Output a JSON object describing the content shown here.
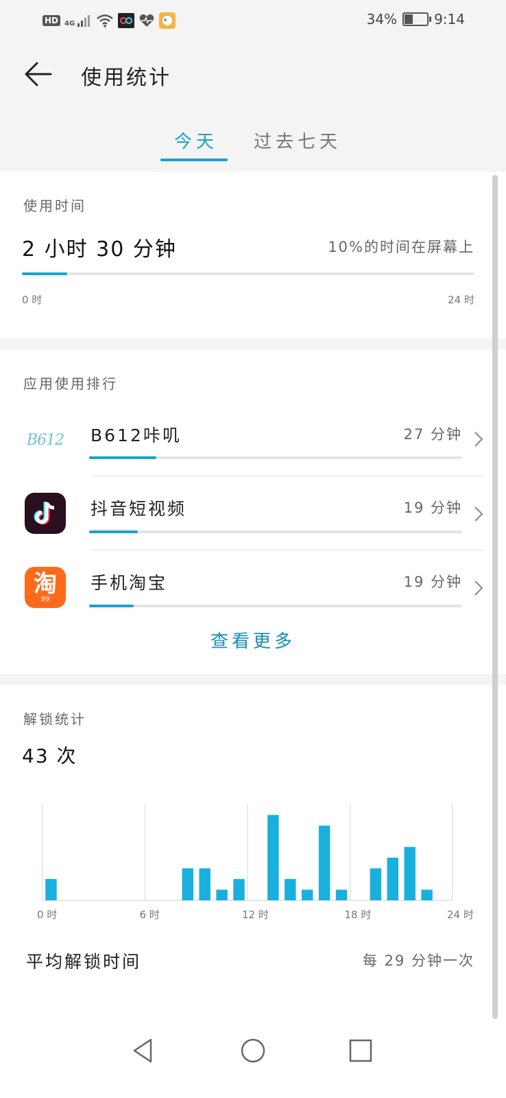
{
  "status_bar": {
    "network_hd": "HD",
    "network_4g": "4G",
    "battery_percent": "34%",
    "battery_level": 0.34,
    "time": "9:14"
  },
  "header": {
    "title": "使用统计",
    "tabs": [
      {
        "label": "今天",
        "selected": true
      },
      {
        "label": "过去七天",
        "selected": false
      }
    ]
  },
  "usage": {
    "section_label": "使用时间",
    "total": "2 小时 30 分钟",
    "screen_percent_text": "10%的时间在屏幕上",
    "progress_fraction": 0.1,
    "start_label": "0 时",
    "end_label": "24 时"
  },
  "ranking": {
    "section_label": "应用使用排行",
    "apps": [
      {
        "name": "B612咔叽",
        "time": "27 分钟",
        "fraction": 0.18,
        "icon": "b612-icon",
        "icon_text": "B612"
      },
      {
        "name": "抖音短视频",
        "time": "19 分钟",
        "fraction": 0.13,
        "icon": "douyin-icon"
      },
      {
        "name": "手机淘宝",
        "time": "19 分钟",
        "fraction": 0.12,
        "icon": "taobao-icon",
        "icon_text": "淘",
        "icon_sub": "99"
      }
    ],
    "see_more": "查看更多"
  },
  "unlock": {
    "section_label": "解锁统计",
    "count": "43 次",
    "avg_label": "平均解锁时间",
    "avg_value": "每 29 分钟一次"
  },
  "chart_data": {
    "type": "bar",
    "x_tick_labels": [
      "0 时",
      "6 时",
      "12 时",
      "18 时",
      "24 时"
    ],
    "xlim": [
      0,
      24
    ],
    "ylim": [
      0,
      9
    ],
    "bar_color": "#1ab0dd",
    "x": [
      0.5,
      8.5,
      9.5,
      10.5,
      11.5,
      13.5,
      14.5,
      15.5,
      16.5,
      17.5,
      19.5,
      20.5,
      21.5,
      22.5
    ],
    "values": [
      2,
      3,
      3,
      1,
      2,
      8,
      2,
      1,
      7,
      1,
      3,
      4,
      5,
      1
    ]
  },
  "colors": {
    "accent": "#1aa3c9",
    "background": "#f4f4f4",
    "card": "#ffffff"
  }
}
